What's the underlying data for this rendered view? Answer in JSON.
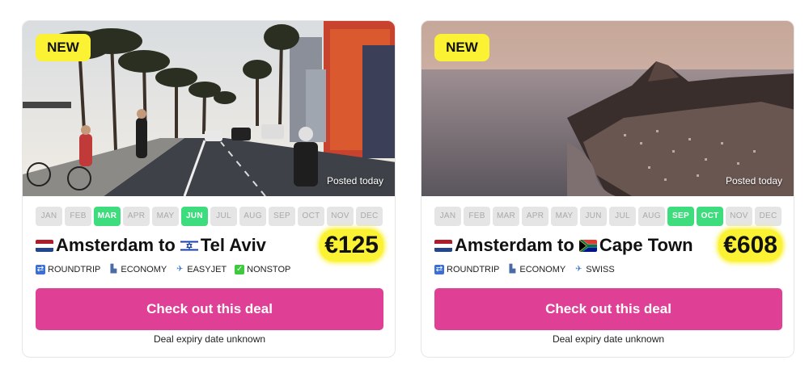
{
  "months": [
    "JAN",
    "FEB",
    "MAR",
    "APR",
    "MAY",
    "JUN",
    "JUL",
    "AUG",
    "SEP",
    "OCT",
    "NOV",
    "DEC"
  ],
  "cards": [
    {
      "badge": "NEW",
      "posted": "Posted today",
      "active_months": [
        "MAR",
        "JUN"
      ],
      "from": "Amsterdam",
      "connector": "to",
      "to": "Tel Aviv",
      "from_flag": "nl-flag",
      "to_flag": "il-flag",
      "price": "€125",
      "tags": [
        {
          "icon": "roundtrip-icon",
          "label": "ROUNDTRIP"
        },
        {
          "icon": "seat-icon",
          "label": "ECONOMY"
        },
        {
          "icon": "airplane-icon",
          "label": "EASYJET"
        },
        {
          "icon": "check-icon",
          "label": "NONSTOP"
        }
      ],
      "cta": "Check out this deal",
      "expiry": "Deal expiry date unknown"
    },
    {
      "badge": "NEW",
      "posted": "Posted today",
      "active_months": [
        "SEP",
        "OCT"
      ],
      "from": "Amsterdam",
      "connector": "to",
      "to": "Cape Town",
      "from_flag": "nl-flag",
      "to_flag": "za-flag",
      "price": "€608",
      "tags": [
        {
          "icon": "roundtrip-icon",
          "label": "ROUNDTRIP"
        },
        {
          "icon": "seat-icon",
          "label": "ECONOMY"
        },
        {
          "icon": "airplane-icon",
          "label": "SWISS"
        }
      ],
      "cta": "Check out this deal",
      "expiry": "Deal expiry date unknown"
    }
  ],
  "colors": {
    "accent": "#e03f96",
    "highlight": "#fbf233",
    "month_active": "#3ddc7d",
    "month_inactive": "#e5e5e5"
  }
}
